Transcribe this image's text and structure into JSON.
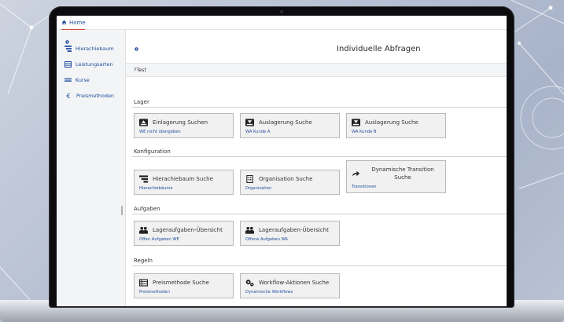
{
  "topbar": {
    "home_label": "Home"
  },
  "sidebar": {
    "items": [
      {
        "label": "Hierachiebaum",
        "icon": "hierarchy-icon"
      },
      {
        "label": "Leistungsarten",
        "icon": "table-icon"
      },
      {
        "label": "Kurse",
        "icon": "courses-icon"
      },
      {
        "label": "Preismethoden",
        "icon": "euro-icon"
      }
    ]
  },
  "main": {
    "title": "Individuelle Abfragen",
    "filter_text": "?Test"
  },
  "sections": [
    {
      "title": "Lager",
      "tiles": [
        {
          "title": "Einlagerung Suchen",
          "subtitle": "WE nicht übergeben",
          "icon": "storage-in-icon"
        },
        {
          "title": "Auslagerung Suche",
          "subtitle": "WA Kunde A",
          "icon": "storage-out-icon"
        },
        {
          "title": "Auslagerung Suche",
          "subtitle": "WA Kunde B",
          "icon": "storage-out-icon"
        }
      ]
    },
    {
      "title": "Konfiguration",
      "tiles": [
        {
          "title": "Hierachiebaum Suche",
          "subtitle": "Hierachiebäume",
          "icon": "hierarchy-icon"
        },
        {
          "title": "Organisation Suche",
          "subtitle": "Organisation",
          "icon": "building-icon"
        },
        {
          "title": "Dynamische Transition Suche",
          "subtitle": "Transitionen",
          "icon": "arrow-icon"
        }
      ]
    },
    {
      "title": "Aufgaben",
      "tiles": [
        {
          "title": "Lageraufgaben-Übersicht",
          "subtitle": "Offen Aufgaben WE",
          "icon": "users-icon"
        },
        {
          "title": "Lageraufgaben-Übersicht",
          "subtitle": "Offene Aufgaben WA",
          "icon": "users-icon"
        }
      ]
    },
    {
      "title": "Regeln",
      "tiles": [
        {
          "title": "Preismethode Suche",
          "subtitle": "Preismethoden",
          "icon": "list-icon"
        },
        {
          "title": "Workflow-Aktionen Suche",
          "subtitle": "Dynamische Workflows",
          "icon": "gears-icon"
        }
      ]
    }
  ],
  "colors": {
    "accent": "#1f4d9c",
    "tile_bg": "#f1f1f1",
    "tab_underline": "#d04a3a"
  }
}
